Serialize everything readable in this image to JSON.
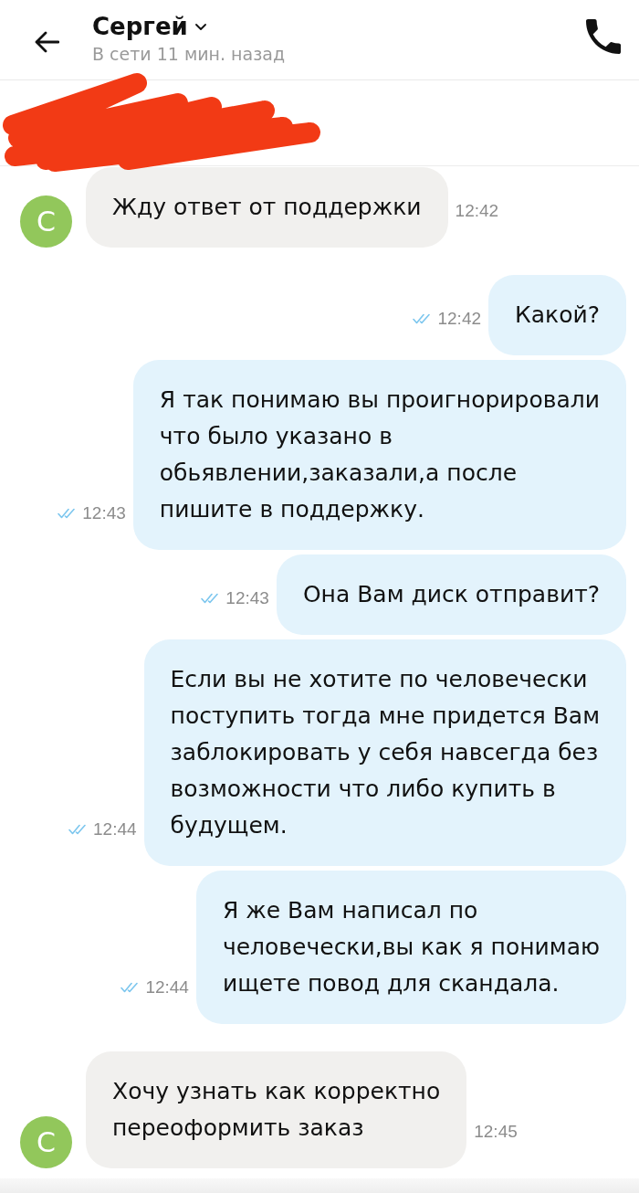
{
  "header": {
    "title": "Сергей",
    "status": "В сети 11 мин. назад"
  },
  "messages": [
    {
      "kind": "incoming",
      "avatar": "С",
      "text": "Жду ответ от поддержки",
      "time": "12:42"
    },
    {
      "kind": "outgoing",
      "text": "Какой?",
      "time": "12:42",
      "read": true
    },
    {
      "kind": "outgoing",
      "text": "Я так понимаю вы проигнорировали\nчто было указано в\nобьявлении,заказали,а после\nпишите в поддержку.",
      "time": "12:43",
      "read": true
    },
    {
      "kind": "outgoing",
      "text": "Она Вам диск отправит?",
      "time": "12:43",
      "read": true
    },
    {
      "kind": "outgoing",
      "text": "Если вы не хотите по человечески\nпоступить тогда мне придется Вам\nзаблокировать у себя навсегда без\nвозможности что либо купить в\nбудущем.",
      "time": "12:44",
      "read": true
    },
    {
      "kind": "outgoing",
      "text": "Я же Вам написал по\nчеловечески,вы как я понимаю\nищете повод для скандала.",
      "time": "12:44",
      "read": true
    },
    {
      "kind": "incoming",
      "avatar": "С",
      "text": "Хочу узнать как корректно\nпереоформить заказ",
      "time": "12:45"
    }
  ]
}
